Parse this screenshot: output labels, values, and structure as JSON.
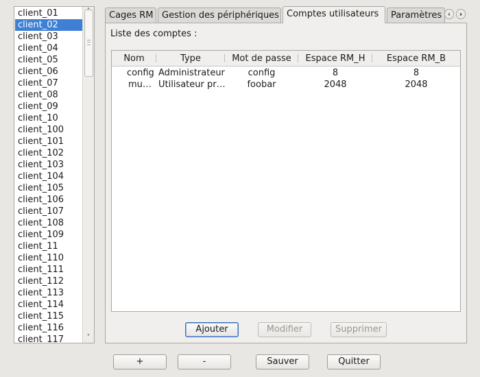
{
  "clients": {
    "selected_index": 1,
    "items": [
      "client_01",
      "client_02",
      "client_03",
      "client_04",
      "client_05",
      "client_06",
      "client_07",
      "client_08",
      "client_09",
      "client_10",
      "client_100",
      "client_101",
      "client_102",
      "client_103",
      "client_104",
      "client_105",
      "client_106",
      "client_107",
      "client_108",
      "client_109",
      "client_11",
      "client_110",
      "client_111",
      "client_112",
      "client_113",
      "client_114",
      "client_115",
      "client_116",
      "client_117"
    ]
  },
  "scrollbar": {
    "up_glyph": "˄",
    "down_glyph": "˅",
    "position_fraction": 0.0
  },
  "tabs": {
    "items": [
      "Cages RM",
      "Gestion des périphériques",
      "Comptes utilisateurs",
      "Paramètres"
    ],
    "active_index": 2,
    "scroll_left_glyph": "‹",
    "scroll_right_glyph": "›"
  },
  "accounts": {
    "label": "Liste des comptes :",
    "columns": [
      "Nom",
      "Type",
      "Mot de passe",
      "Espace RM_H",
      "Espace RM_B"
    ],
    "rows": [
      [
        "config",
        "Administrateur",
        "config",
        "8",
        "8"
      ],
      [
        "mu…",
        "Utilisateur pr…",
        "foobar",
        "2048",
        "2048"
      ]
    ],
    "buttons": {
      "add": "Ajouter",
      "edit": "Modifier",
      "delete": "Supprimer"
    }
  },
  "bottom_buttons": {
    "plus": "+",
    "minus": "-",
    "save": "Sauver",
    "quit": "Quitter"
  },
  "colors": {
    "selection": "#3f7fd4",
    "window_bg": "#e8e7e4",
    "focus_border": "#3b6fb6"
  }
}
